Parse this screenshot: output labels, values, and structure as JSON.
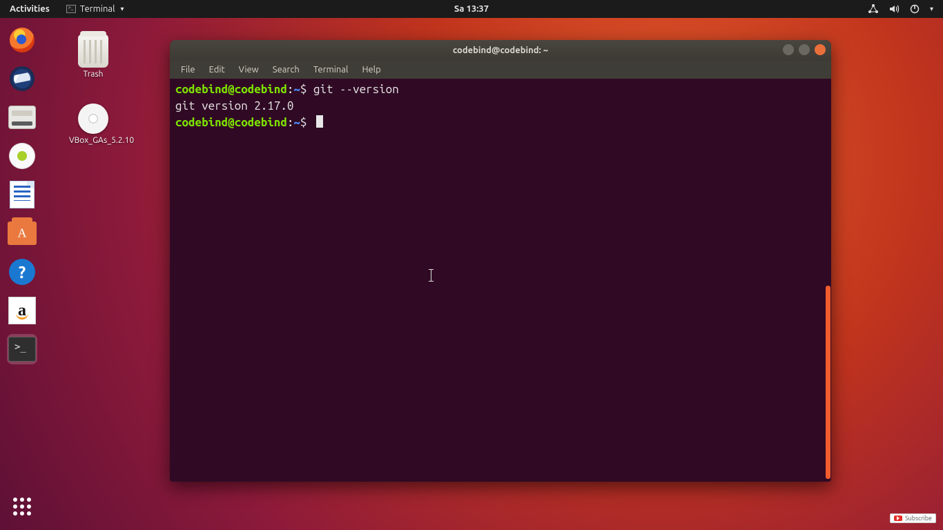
{
  "topbar": {
    "activities": "Activities",
    "app_label": "Terminal",
    "clock": "Sa 13:37"
  },
  "desktop": {
    "trash_label": "Trash",
    "vbox_label": "VBox_GAs_5.2.10"
  },
  "terminal": {
    "title": "codebind@codebind: ~",
    "menu": [
      "File",
      "Edit",
      "View",
      "Search",
      "Terminal",
      "Help"
    ],
    "prompt_user": "codebind@codebind",
    "prompt_sep": ":",
    "prompt_path": "~",
    "prompt_sym": "$ ",
    "line1_cmd": "git --version",
    "line2_out": "git version 2.17.0"
  },
  "subscribe": "Subscribe"
}
